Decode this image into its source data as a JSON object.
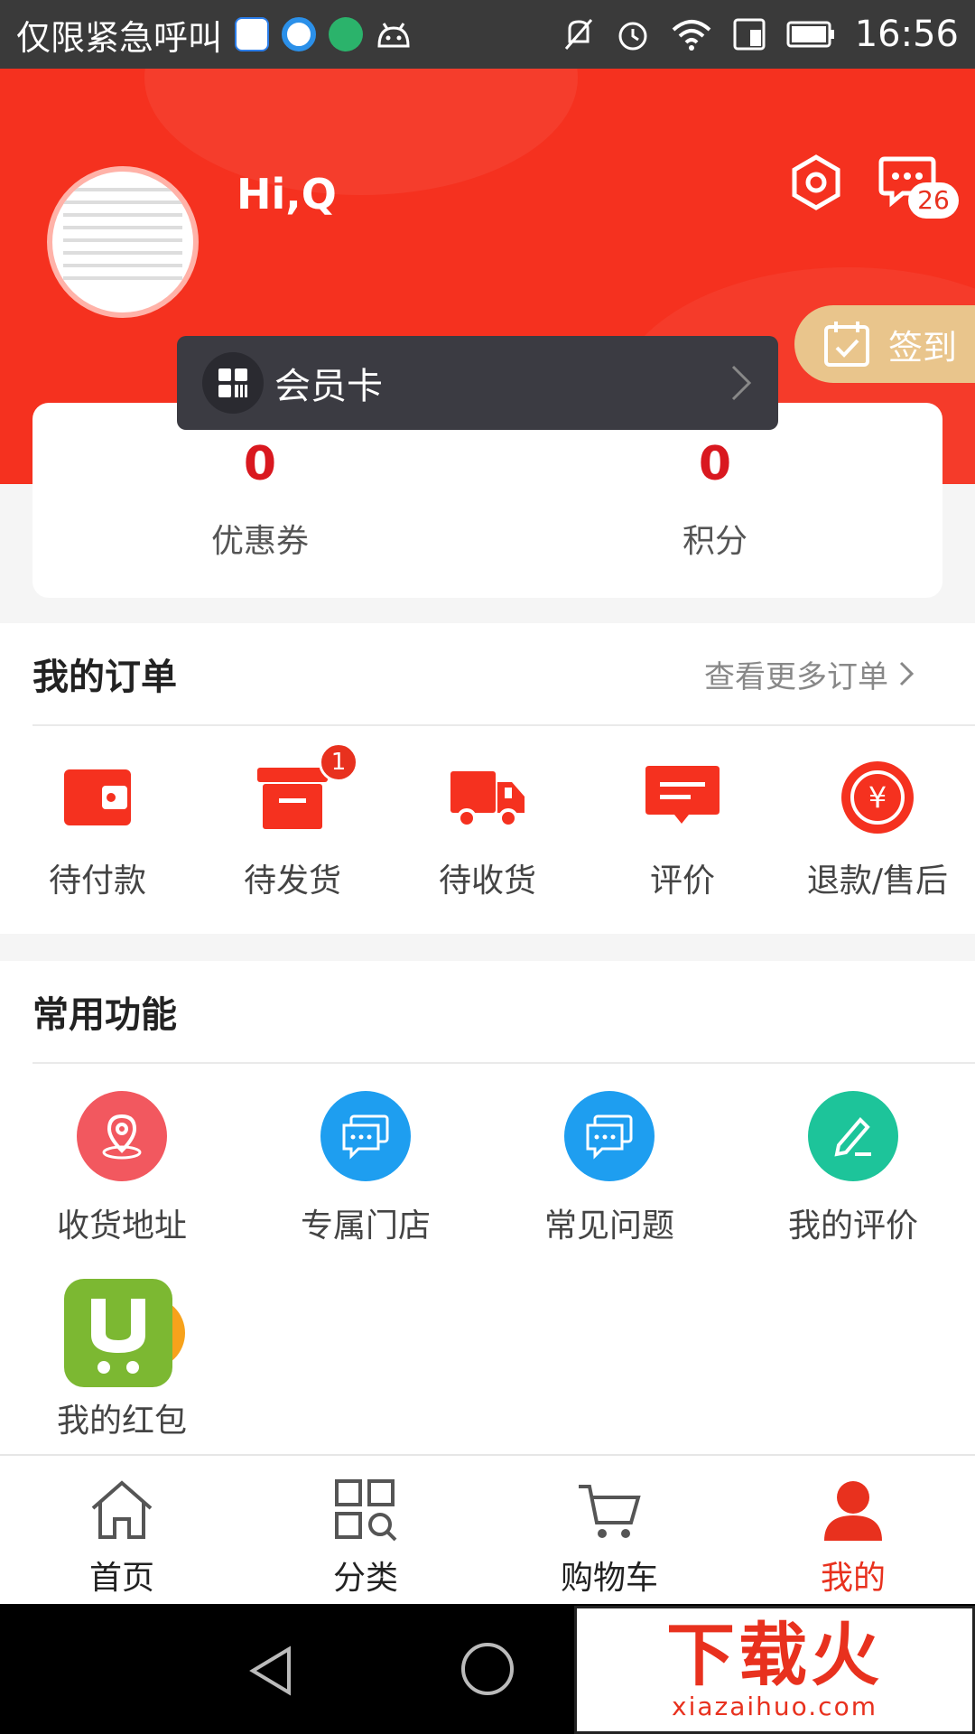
{
  "statusbar": {
    "carrier": "仅限紧急呼叫",
    "time": "16:56"
  },
  "header": {
    "greeting": "Hi,Q",
    "message_count": "26",
    "signin_label": "签到",
    "member_card_label": "会员卡"
  },
  "stats": [
    {
      "value": "0",
      "label": "优惠券"
    },
    {
      "value": "0",
      "label": "积分"
    }
  ],
  "orders": {
    "title": "我的订单",
    "more": "查看更多订单",
    "items": [
      {
        "label": "待付款",
        "icon": "wallet-icon"
      },
      {
        "label": "待发货",
        "icon": "box-icon",
        "badge": "1"
      },
      {
        "label": "待收货",
        "icon": "truck-icon"
      },
      {
        "label": "评价",
        "icon": "comment-icon"
      },
      {
        "label": "退款/售后",
        "icon": "refund-icon"
      }
    ]
  },
  "functions": {
    "title": "常用功能",
    "items": [
      {
        "label": "收货地址",
        "icon": "location-icon",
        "color": "#f2585f"
      },
      {
        "label": "专属门店",
        "icon": "chat-icon",
        "color": "#1e9ef0"
      },
      {
        "label": "常见问题",
        "icon": "chat-icon",
        "color": "#1e9ef0"
      },
      {
        "label": "我的评价",
        "icon": "edit-icon",
        "color": "#1dc49a"
      },
      {
        "label": "我的红包",
        "icon": "redpacket-app-icon",
        "color": "#7cb832"
      }
    ]
  },
  "tabbar": [
    {
      "label": "首页",
      "icon": "home-icon"
    },
    {
      "label": "分类",
      "icon": "category-icon"
    },
    {
      "label": "购物车",
      "icon": "cart-icon"
    },
    {
      "label": "我的",
      "icon": "user-icon",
      "active": true
    }
  ],
  "watermark": {
    "big": "下载火",
    "small": "xiazaihuo.com"
  },
  "colors": {
    "primary": "#f5311f",
    "accent_red": "#e8311e",
    "gold": "#e9c58c"
  }
}
